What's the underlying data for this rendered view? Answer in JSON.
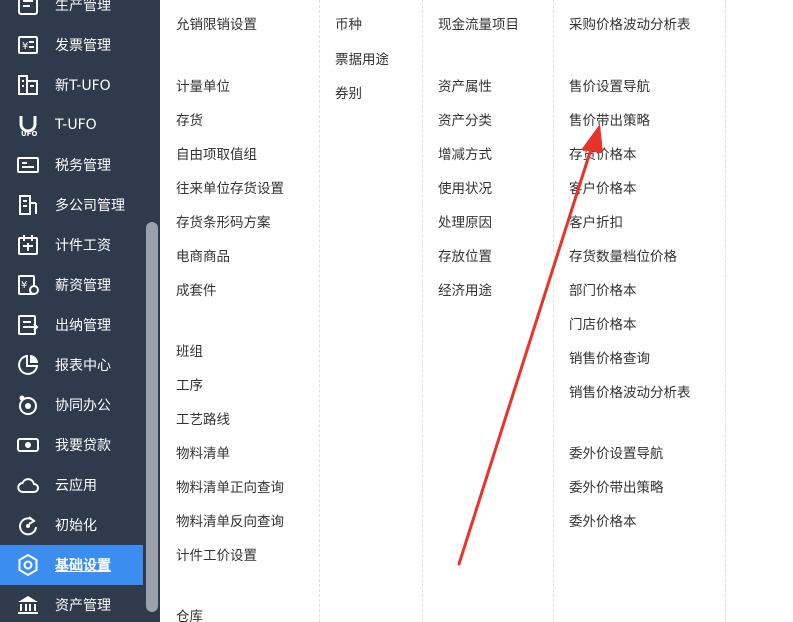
{
  "sidebar": {
    "items": [
      {
        "label": "生产管理",
        "icon": "production-icon"
      },
      {
        "label": "发票管理",
        "icon": "invoice-icon"
      },
      {
        "label": "新T-UFO",
        "icon": "building-icon"
      },
      {
        "label": "T-UFO",
        "icon": "ufo-icon"
      },
      {
        "label": "税务管理",
        "icon": "tax-icon"
      },
      {
        "label": "多公司管理",
        "icon": "multi-company-icon"
      },
      {
        "label": "计件工资",
        "icon": "piecework-icon"
      },
      {
        "label": "薪资管理",
        "icon": "salary-icon"
      },
      {
        "label": "出纳管理",
        "icon": "cashier-icon"
      },
      {
        "label": "报表中心",
        "icon": "pie-chart-icon"
      },
      {
        "label": "协同办公",
        "icon": "collaboration-icon"
      },
      {
        "label": "我要贷款",
        "icon": "loan-icon"
      },
      {
        "label": "云应用",
        "icon": "cloud-icon"
      },
      {
        "label": "初始化",
        "icon": "refresh-icon"
      },
      {
        "label": "基础设置",
        "icon": "settings-icon",
        "active": true
      },
      {
        "label": "资产管理",
        "icon": "bank-icon"
      }
    ]
  },
  "columns": {
    "col1": [
      "允销限销设置",
      "计量单位",
      "存货",
      "自由项取值组",
      "往来单位存货设置",
      "存货条形码方案",
      "电商商品",
      "成套件",
      "班组",
      "工序",
      "工艺路线",
      "物料清单",
      "物料清单正向查询",
      "物料清单反向查询",
      "计件工价设置",
      "仓库"
    ],
    "col2": [
      "币种",
      "票据用途",
      "券别"
    ],
    "col3": [
      "现金流量项目",
      "资产属性",
      "资产分类",
      "增减方式",
      "使用状况",
      "处理原因",
      "存放位置",
      "经济用途"
    ],
    "col4": [
      "采购价格波动分析表",
      "售价设置导航",
      "售价带出策略",
      "存货价格本",
      "客户价格本",
      "客户折扣",
      "存货数量档位价格",
      "部门价格本",
      "门店价格本",
      "销售价格查询",
      "销售价格波动分析表",
      "委外价设置导航",
      "委外价带出策略",
      "委外价格本"
    ]
  },
  "annotation": {
    "color": "#e8332b"
  },
  "colors": {
    "sidebar_bg": "#2f3a4c",
    "active_bg": "#3b8df0",
    "text": "#333333"
  }
}
